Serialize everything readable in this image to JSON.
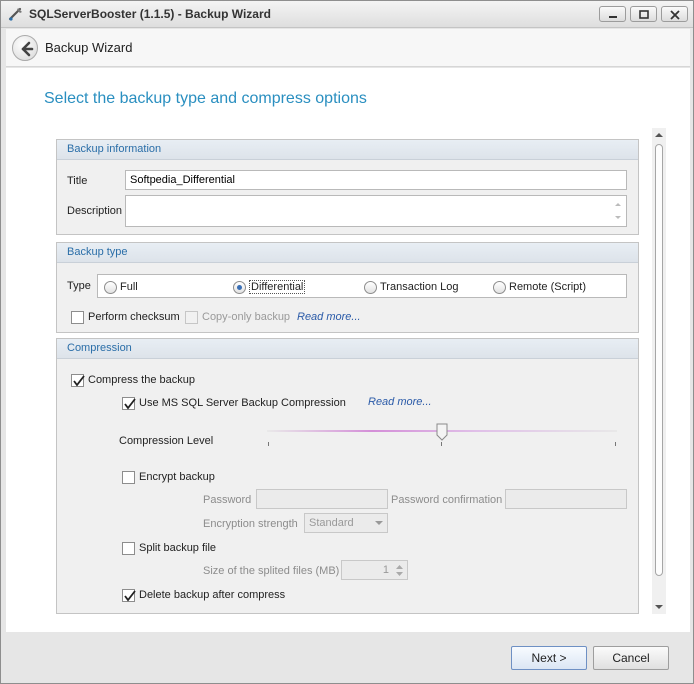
{
  "window": {
    "title": "SQLServerBooster (1.1.5) - Backup Wizard"
  },
  "header": {
    "title": "Backup Wizard"
  },
  "page": {
    "heading": "Select the backup type and compress options"
  },
  "backup_information": {
    "header": "Backup information",
    "title_label": "Title",
    "title_value": "Softpedia_Differential",
    "description_label": "Description",
    "description_value": ""
  },
  "backup_type": {
    "header": "Backup type",
    "type_label": "Type",
    "options": [
      {
        "label": "Full",
        "selected": false
      },
      {
        "label": "Differential",
        "selected": true
      },
      {
        "label": "Transaction Log",
        "selected": false
      },
      {
        "label": "Remote (Script)",
        "selected": false
      }
    ],
    "perform_checksum": {
      "label": "Perform checksum",
      "checked": false
    },
    "copy_only": {
      "label": "Copy-only backup",
      "checked": false,
      "enabled": false
    },
    "read_more": "Read more..."
  },
  "compression": {
    "header": "Compression",
    "compress_backup": {
      "label": "Compress the backup",
      "checked": true
    },
    "use_ms_compression": {
      "label": "Use MS SQL Server Backup Compression",
      "checked": true
    },
    "read_more": "Read more...",
    "compression_level_label": "Compression Level",
    "compression_level_fraction": 0.5,
    "encrypt_backup": {
      "label": "Encrypt backup",
      "checked": false
    },
    "password_label": "Password",
    "password_confirmation_label": "Password confirmation",
    "encryption_strength_label": "Encryption strength",
    "encryption_strength_value": "Standard",
    "split_backup": {
      "label": "Split backup file",
      "checked": false
    },
    "split_size_label": "Size of the splited files (MB)",
    "split_size_value": "1",
    "delete_after_compress": {
      "label": "Delete backup after compress",
      "checked": true
    }
  },
  "footer": {
    "next_label": "Next >",
    "cancel_label": "Cancel"
  }
}
